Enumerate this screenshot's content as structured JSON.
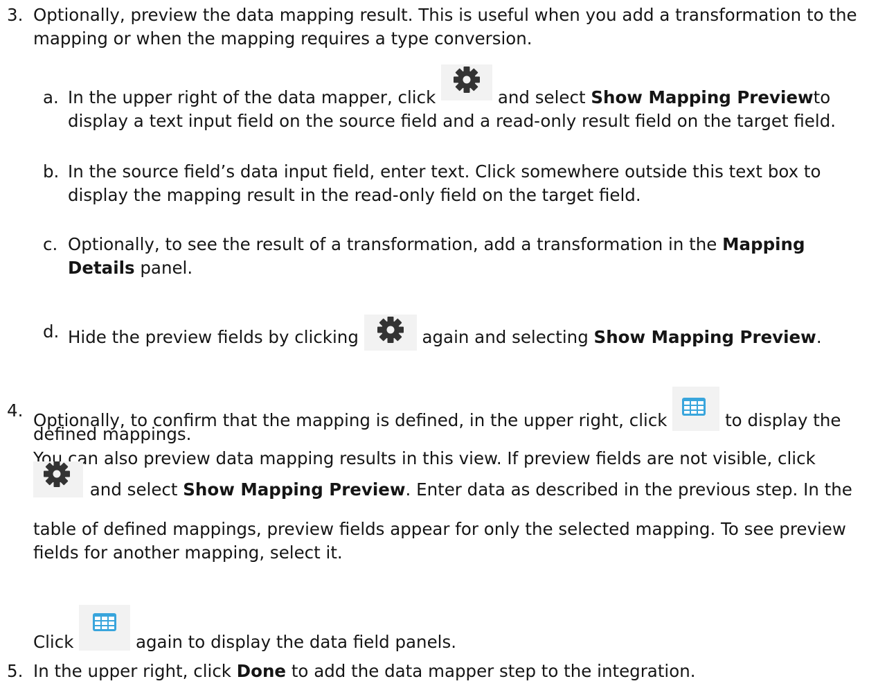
{
  "step3": {
    "number": "3.",
    "line1": "Optionally, preview the data mapping result. This is useful when you add a transformation to the",
    "line2": "mapping or when the mapping requires a type conversion.",
    "sub_a": {
      "letter": "a.",
      "pre": "In the upper right of the data mapper, click",
      "mid": "and select",
      "bold": "Show Mapping Preview",
      "post": "to",
      "line2": "display a text input field on the source field and a read-only result field on the target field."
    },
    "sub_b": {
      "letter": "b.",
      "line1": "In the source field’s data input field, enter text. Click somewhere outside this text box to",
      "line2": "display the mapping result in the read-only field on the target field."
    },
    "sub_c": {
      "letter": "c.",
      "pre": "Optionally, to see the result of a transformation, add a transformation in the",
      "bold1": "Mapping",
      "bold2": "Details",
      "post": "panel."
    },
    "sub_d": {
      "letter": "d.",
      "pre": "Hide the preview fields by clicking",
      "mid": "again and selecting",
      "bold": "Show Mapping Preview",
      "post": "."
    }
  },
  "step4": {
    "number": "4.",
    "pre": "Optionally, to confirm that the mapping is defined, in the upper right, click",
    "post": "to display the",
    "line2": "defined mappings.",
    "line3": "You can also preview data mapping results in this view. If preview fields are not visible, click",
    "line4_mid": "and select",
    "line4_bold": "Show Mapping Preview",
    "line4_post": ". Enter data as described in the previous step. In the",
    "line5": "table of defined mappings, preview fields appear for only the selected mapping. To see preview",
    "line6": "fields for another mapping, select it.",
    "click_pre": "Click",
    "click_post": "again to display the data field panels."
  },
  "step5": {
    "number": "5.",
    "pre": "In the upper right, click",
    "bold": "Done",
    "post": "to add the data mapper step to the integration."
  },
  "icons": {
    "gear_color": "#333333",
    "grid_color": "#39a5dc"
  }
}
